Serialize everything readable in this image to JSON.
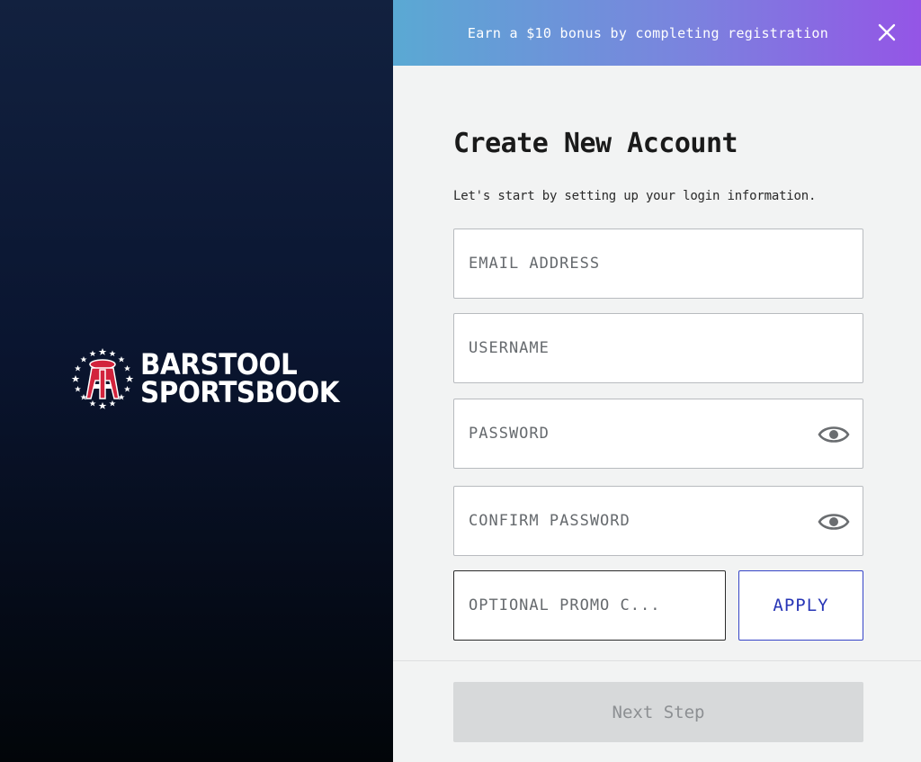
{
  "brand": {
    "line1": "BARSTOOL",
    "line2": "SPORTSBOOK",
    "colors": {
      "logo_red": "#d2233c",
      "logo_white": "#ffffff"
    }
  },
  "banner": {
    "text": "Earn a $10 bonus by completing registration",
    "close_icon": "close-icon"
  },
  "form": {
    "title": "Create New Account",
    "subtitle": "Let's start by setting up your login information.",
    "fields": {
      "email": {
        "placeholder": "EMAIL ADDRESS",
        "value": ""
      },
      "username": {
        "placeholder": "USERNAME",
        "value": ""
      },
      "password": {
        "placeholder": "PASSWORD",
        "value": "",
        "toggle_icon": "eye-icon"
      },
      "confirm_password": {
        "placeholder": "CONFIRM PASSWORD",
        "value": "",
        "toggle_icon": "eye-icon"
      },
      "promo": {
        "placeholder": "OPTIONAL PROMO C...",
        "value": ""
      }
    },
    "apply_label": "APPLY",
    "next_label": "Next Step"
  },
  "colors": {
    "accent_blue": "#2735b6",
    "banner_start": "#5aa9d3",
    "banner_end": "#9455e6",
    "disabled_bg": "#d7d9da",
    "disabled_text": "#8c8f92"
  }
}
